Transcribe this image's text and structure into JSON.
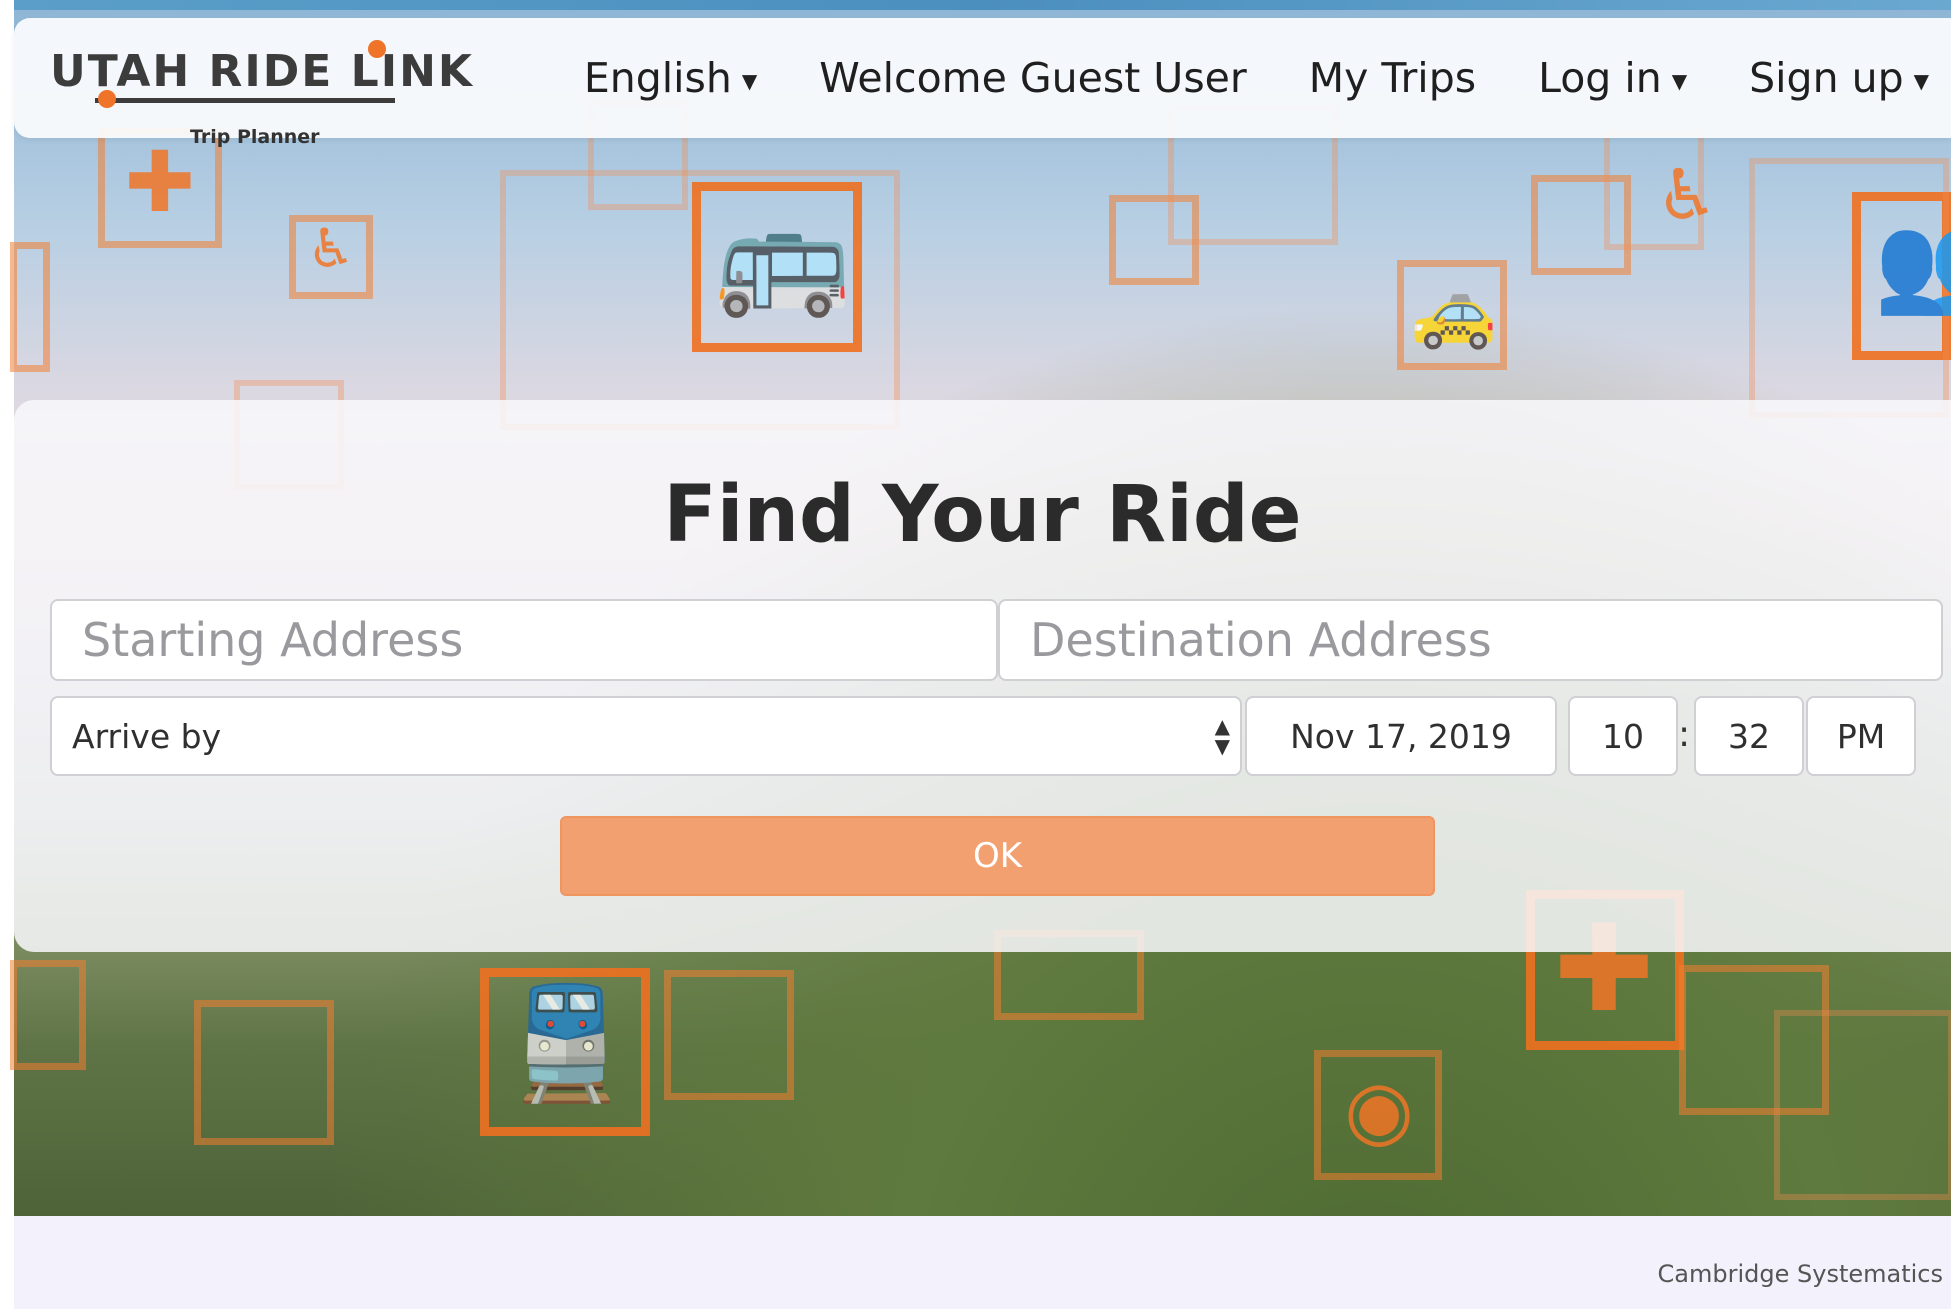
{
  "header": {
    "logo_text": "UTAH RIDE LINK",
    "logo_subtitle": "Trip Planner",
    "nav": [
      {
        "label": "English",
        "dropdown": true
      },
      {
        "label": "Welcome Guest User",
        "dropdown": false
      },
      {
        "label": "My Trips",
        "dropdown": false
      },
      {
        "label": "Log in",
        "dropdown": true
      },
      {
        "label": "Sign up",
        "dropdown": true
      }
    ]
  },
  "search": {
    "title": "Find Your Ride",
    "start_placeholder": "Starting Address",
    "destination_placeholder": "Destination Address",
    "time_mode": "Arrive by",
    "date": "Nov 17, 2019",
    "hour": "10",
    "separator": ":",
    "minute": "32",
    "ampm": "PM",
    "submit_label": "OK"
  },
  "footer": {
    "credit": "Cambridge Systematics"
  },
  "colors": {
    "accent": "#ef7328",
    "button": "#f3a070",
    "nav_text": "#1f1f1f"
  },
  "background_icons": [
    "plus-icon",
    "wheelchair-icon",
    "bus-icon",
    "taxi-icon",
    "group-icon",
    "train-icon",
    "ride-share-icon"
  ]
}
